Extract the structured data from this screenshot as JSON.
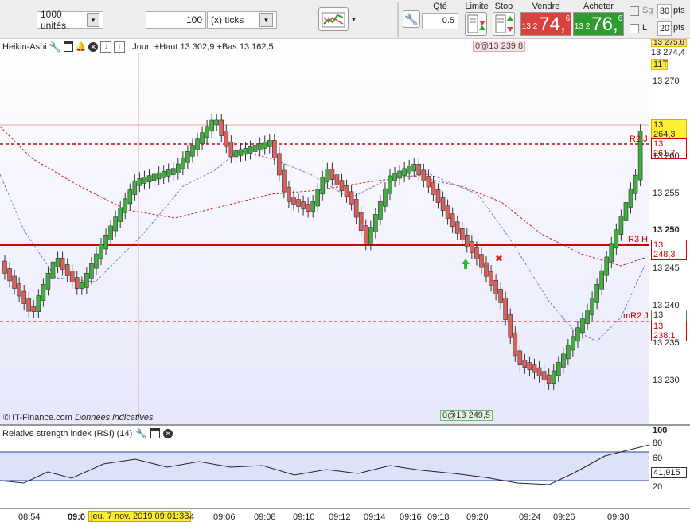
{
  "toolbar": {
    "quantity_select": "1000 unités",
    "ticks_value": "100",
    "ticks_unit_select": "(x) ticks",
    "qty_label": "Qté",
    "qty_value": "0.5",
    "limit_label": "Limite",
    "stop_label": "Stop",
    "sell_label": "Vendre",
    "sell_price_small": "13 2",
    "sell_price_big": "74,",
    "sell_price_sup": "6",
    "buy_label": "Acheter",
    "buy_price_small": "13 2",
    "buy_price_big": "76,",
    "buy_price_sup": "6",
    "sg_label": "Sg",
    "sg_value": "30",
    "pts1": "pts",
    "l_label": "L",
    "l_value": "20",
    "pts2": "pts"
  },
  "price_panel": {
    "title": "Heikin-Ashi",
    "day_info": "Jour :+Haut 13 302,9 +Bas 13 162,5",
    "top_marker": "0@13 239,8",
    "bottom_marker": "0@13 249,5",
    "watermark_source": "© IT-Finance.com",
    "watermark_note": "Données indicatives",
    "y_ticks": [
      "13 270",
      "13 265",
      "13 260",
      "13 255",
      "13 250",
      "13 245",
      "13 240",
      "13 235",
      "13 230"
    ],
    "top_cut_label": "13 275,6",
    "price_tags": {
      "high": "13 274,4",
      "timeframe": "11T",
      "level1": "13 264,3",
      "r2": "13 261,7",
      "r3": "13 248,3",
      "green": "13 238,1",
      "mr2": "13 238,1"
    },
    "line_labels": {
      "r2": "R2 J",
      "r3": "R3 H",
      "mr2": "mR2 J"
    }
  },
  "rsi_panel": {
    "title": "Relative strength index (RSI) (14)",
    "y_ticks": [
      "100",
      "80",
      "60",
      "40",
      "20"
    ],
    "value": "41,915"
  },
  "x_axis": {
    "labels": [
      "08:54",
      "09:0",
      "4",
      "09:06",
      "09:08",
      "09:10",
      "09:12",
      "09:14",
      "09:16",
      "09:18",
      "09:20",
      "09:24",
      "09:26",
      "09:30"
    ],
    "cursor_label": "jeu. 7 nov. 2019 09:01:38"
  },
  "colors": {
    "bull": "#3fae3f",
    "bear": "#d9605b",
    "sell_bg": "#d9433f",
    "buy_bg": "#2e9c2e",
    "r_line": "#d00000"
  }
}
